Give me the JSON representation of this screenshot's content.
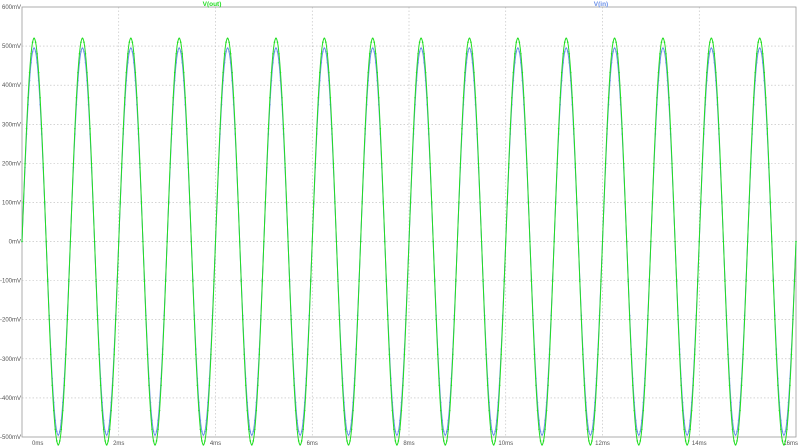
{
  "chart_data": {
    "type": "line",
    "grid": true,
    "xlim": [
      0,
      16
    ],
    "ylim": [
      -500,
      600
    ],
    "x_unit": "ms",
    "y_unit": "mV",
    "x_ticks": [
      "0ms",
      "2ms",
      "4ms",
      "6ms",
      "8ms",
      "10ms",
      "12ms",
      "14ms",
      "16ms"
    ],
    "y_ticks": [
      "600mV",
      "500mV",
      "400mV",
      "300mV",
      "200mV",
      "100mV",
      "0mV",
      "-100mV",
      "-200mV",
      "-300mV",
      "-400mV",
      "-500mV"
    ],
    "legend_placement": "top",
    "series": [
      {
        "name": "V(out)",
        "color": "#22dd22",
        "x": [
          0,
          0.25,
          0.5,
          0.75,
          1,
          1.25,
          1.5,
          1.75,
          2,
          2.25,
          2.5,
          2.75,
          3,
          3.25,
          3.5,
          3.75,
          4,
          4.25,
          4.5,
          4.75,
          5,
          5.25,
          5.5,
          5.75,
          6,
          6.25,
          6.5,
          6.75,
          7,
          7.25,
          7.5,
          7.75,
          8,
          8.25,
          8.5,
          8.75,
          9,
          9.25,
          9.5,
          9.75,
          10,
          10.25,
          10.5,
          10.75,
          11,
          11.25,
          11.5,
          11.75,
          12,
          12.25,
          12.5,
          12.75,
          13,
          13.25,
          13.5,
          13.75,
          14,
          14.25,
          14.5,
          14.75,
          15,
          15.25,
          15.5,
          15.75,
          16
        ],
        "y": [
          0,
          520,
          0,
          -520,
          0,
          520,
          0,
          -520,
          0,
          520,
          0,
          -520,
          0,
          520,
          0,
          -520,
          0,
          520,
          0,
          -520,
          0,
          520,
          0,
          -520,
          0,
          520,
          0,
          -520,
          0,
          520,
          0,
          -520,
          0,
          520,
          0,
          -520,
          0,
          520,
          0,
          -520,
          0,
          520,
          0,
          -520,
          0,
          520,
          0,
          -520,
          0,
          520,
          0,
          -520,
          0,
          520,
          0,
          -520,
          0,
          520,
          0,
          -520,
          0,
          520,
          0,
          -520,
          0
        ]
      },
      {
        "name": "V(in)",
        "color": "#6a8fe8",
        "x": [
          0,
          0.25,
          0.5,
          0.75,
          1,
          1.25,
          1.5,
          1.75,
          2,
          2.25,
          2.5,
          2.75,
          3,
          3.25,
          3.5,
          3.75,
          4,
          4.25,
          4.5,
          4.75,
          5,
          5.25,
          5.5,
          5.75,
          6,
          6.25,
          6.5,
          6.75,
          7,
          7.25,
          7.5,
          7.75,
          8,
          8.25,
          8.5,
          8.75,
          9,
          9.25,
          9.5,
          9.75,
          10,
          10.25,
          10.5,
          10.75,
          11,
          11.25,
          11.5,
          11.75,
          12,
          12.25,
          12.5,
          12.75,
          13,
          13.25,
          13.5,
          13.75,
          14,
          14.25,
          14.5,
          14.75,
          15,
          15.25,
          15.5,
          15.75,
          16
        ],
        "y": [
          0,
          495,
          0,
          -495,
          0,
          495,
          0,
          -495,
          0,
          495,
          0,
          -495,
          0,
          495,
          0,
          -495,
          0,
          495,
          0,
          -495,
          0,
          495,
          0,
          -495,
          0,
          495,
          0,
          -495,
          0,
          495,
          0,
          -495,
          0,
          495,
          0,
          -495,
          0,
          495,
          0,
          -495,
          0,
          495,
          0,
          -495,
          0,
          495,
          0,
          -495,
          0,
          495,
          0,
          -495,
          0,
          495,
          0,
          -495,
          0,
          495,
          0,
          -495,
          0,
          495,
          0,
          -495,
          0
        ]
      }
    ]
  }
}
